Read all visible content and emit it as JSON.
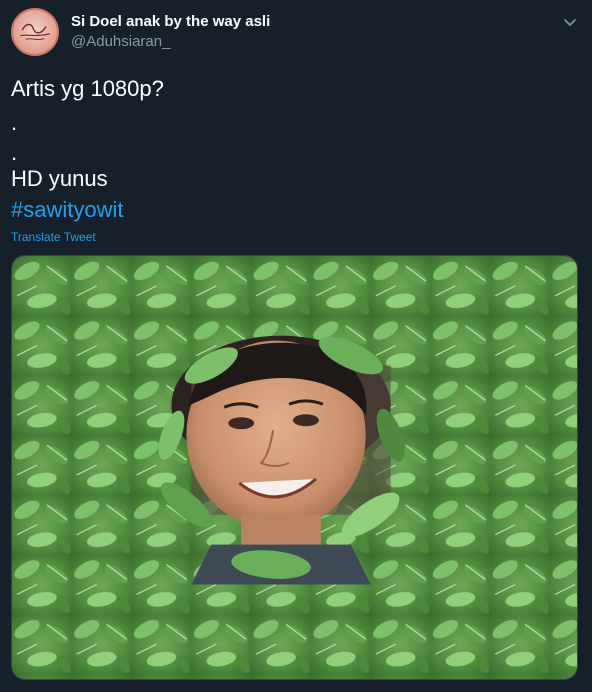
{
  "tweet": {
    "display_name": "Si Doel anak by the way asli",
    "handle": "@Aduhsiaran_",
    "lines": [
      "Artis yg 1080p?",
      ".",
      ".",
      "HD yunus"
    ],
    "hashtag": "#sawityowit",
    "translate_label": "Translate Tweet",
    "avatar_icon": "avatar-logo-icon",
    "more_icon": "chevron-down-icon",
    "media_description_icon": "photo-leaves-face"
  },
  "colors": {
    "background": "#15202b",
    "text": "#ffffff",
    "secondary": "#8899a6",
    "link": "#1da1f2"
  }
}
